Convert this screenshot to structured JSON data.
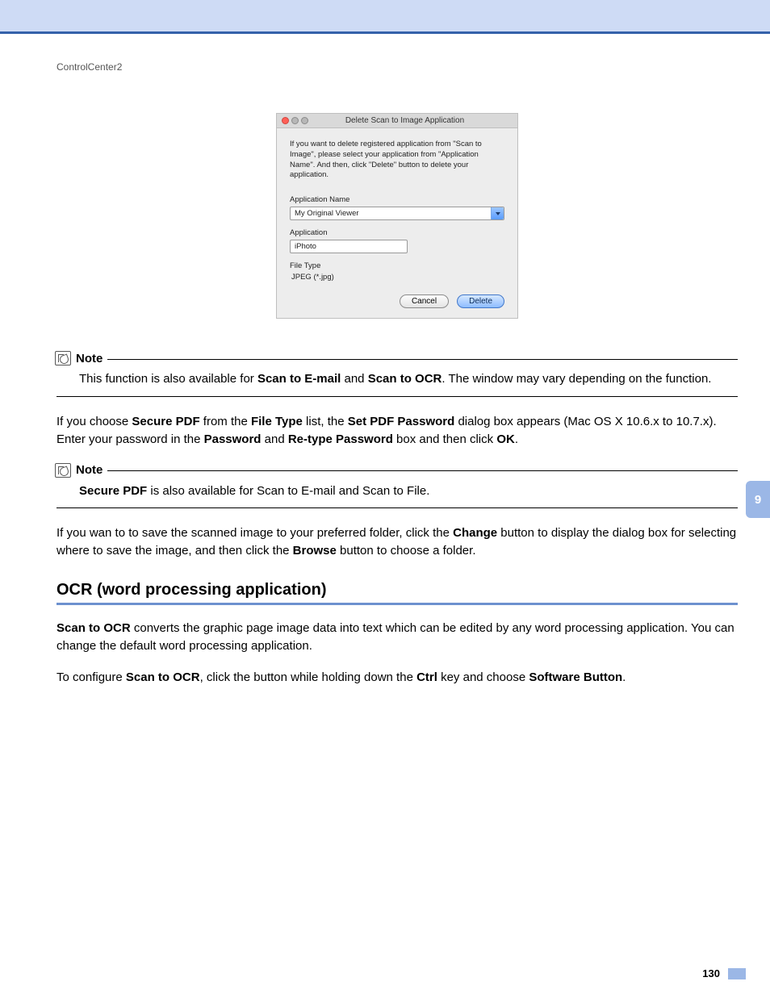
{
  "breadcrumb": "ControlCenter2",
  "dialog": {
    "title": "Delete Scan to Image Application",
    "desc": "If you want to delete registered application from \"Scan to Image\", please select your application from \"Application Name\". And then, click \"Delete\" button to delete your application.",
    "app_name_label": "Application Name",
    "app_name_value": "My Original Viewer",
    "application_label": "Application",
    "application_value": "iPhoto",
    "file_type_label": "File Type",
    "file_type_value": "JPEG (*.jpg)",
    "cancel": "Cancel",
    "delete": "Delete"
  },
  "note1": {
    "label": "Note",
    "body_parts": {
      "p1": "This function is also available for ",
      "b1": "Scan to E-mail",
      "p2": " and ",
      "b2": "Scan to OCR",
      "p3": ". The window may vary depending on the function."
    }
  },
  "para1": {
    "p1": "If you choose ",
    "b1": "Secure PDF",
    "p2": " from the ",
    "b2": "File Type",
    "p3": " list, the ",
    "b3": "Set PDF Password",
    "p4": " dialog box appears (Mac OS X 10.6.x to 10.7.x). Enter your password in the ",
    "b4": "Password",
    "p5": " and ",
    "b5": "Re-type Password",
    "p6": " box and then click ",
    "b6": "OK",
    "p7": "."
  },
  "note2": {
    "label": "Note",
    "b1": "Secure PDF",
    "p1": " is also available for Scan to E-mail and Scan to File."
  },
  "para2": {
    "p1": "If you wan to to save the scanned image to your preferred folder, click the ",
    "b1": "Change",
    "p2": " button to display the dialog box for selecting where to save the image, and then click the ",
    "b2": "Browse",
    "p3": " button to choose a folder."
  },
  "section_title": "OCR (word processing application)",
  "para3": {
    "b1": "Scan to OCR",
    "p1": " converts the graphic page image data into text which can be edited by any word processing application. You can change the default word processing application."
  },
  "para4": {
    "p1": "To configure ",
    "b1": "Scan to OCR",
    "p2": ", click the button while holding down the ",
    "b2": "Ctrl",
    "p3": " key and choose ",
    "b3": "Software Button",
    "p4": "."
  },
  "side_tab": "9",
  "page_number": "130"
}
